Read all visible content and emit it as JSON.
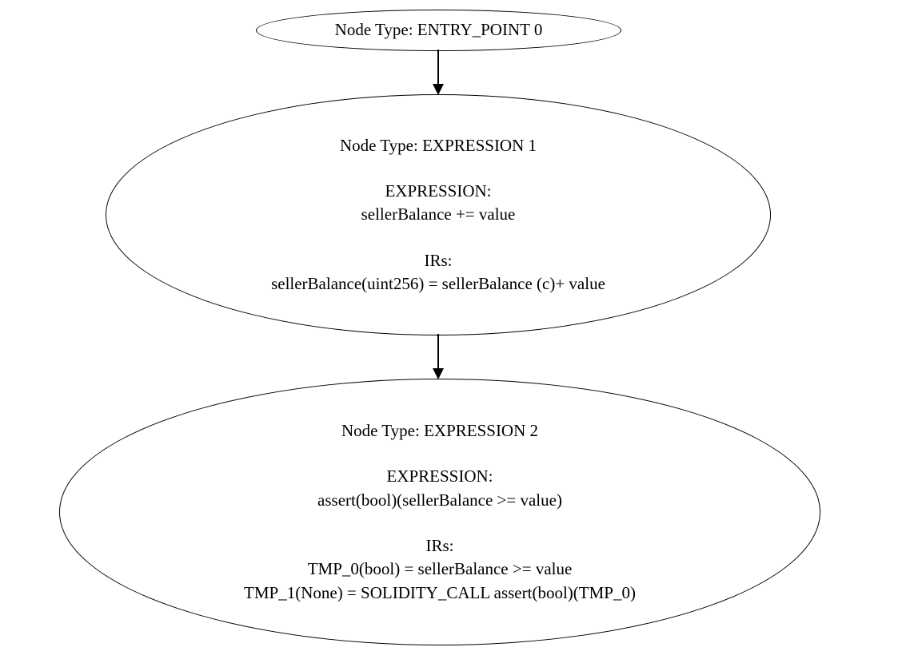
{
  "chart_data": {
    "type": "diagram",
    "title": "",
    "nodes": [
      {
        "id": 0,
        "type": "ENTRY_POINT",
        "header": "Node Type: ENTRY_POINT 0",
        "expression": "",
        "irs": []
      },
      {
        "id": 1,
        "type": "EXPRESSION",
        "header": "Node Type: EXPRESSION 1",
        "expression_label": "EXPRESSION:",
        "expression": "sellerBalance += value",
        "irs_label": "IRs:",
        "irs": "sellerBalance(uint256) = sellerBalance (c)+ value"
      },
      {
        "id": 2,
        "type": "EXPRESSION",
        "header": "Node Type: EXPRESSION 2",
        "expression_label": "EXPRESSION:",
        "expression": "assert(bool)(sellerBalance >= value)",
        "irs_label": "IRs:",
        "irs": "TMP_0(bool) = sellerBalance >= value\nTMP_1(None) = SOLIDITY_CALL assert(bool)(TMP_0)"
      }
    ],
    "edges": [
      {
        "from": 0,
        "to": 1
      },
      {
        "from": 1,
        "to": 2
      }
    ]
  }
}
